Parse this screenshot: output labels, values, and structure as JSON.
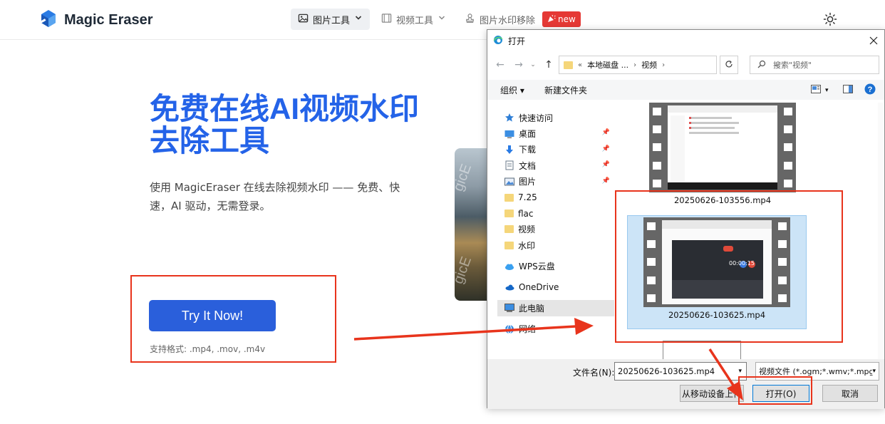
{
  "header": {
    "logo_text": "Magic Eraser",
    "nav": [
      {
        "label": "图片工具",
        "active": true
      },
      {
        "label": "视频工具",
        "active": false
      },
      {
        "label": "图片水印移除",
        "active": false
      }
    ],
    "badge_new": "new"
  },
  "hero": {
    "title": "免费在线AI视频水印去除工具",
    "description": "使用 MagicEraser 在线去除视频水印 —— 免费、快速，AI 驱动，无需登录。",
    "cta_label": "Try It Now!",
    "formats": "支持格式: .mp4, .mov, .m4v",
    "image_watermark_1": "gicE",
    "image_watermark_2": "gicE"
  },
  "dialog": {
    "title": "打开",
    "address": {
      "prefix": "«",
      "part1": "本地磁盘 ...",
      "part2": "视频"
    },
    "search_placeholder": "搜索\"视频\"",
    "toolbar": {
      "organize": "组织",
      "new_folder": "新建文件夹"
    },
    "sidebar": [
      {
        "label": "快速访问",
        "icon": "star-icon"
      },
      {
        "label": "桌面",
        "icon": "desktop-icon",
        "pinned": true
      },
      {
        "label": "下载",
        "icon": "download-icon",
        "pinned": true
      },
      {
        "label": "文档",
        "icon": "document-icon",
        "pinned": true
      },
      {
        "label": "图片",
        "icon": "picture-icon",
        "pinned": true
      },
      {
        "label": "7.25",
        "icon": "folder-icon"
      },
      {
        "label": "flac",
        "icon": "folder-icon"
      },
      {
        "label": "视频",
        "icon": "folder-icon"
      },
      {
        "label": "水印",
        "icon": "folder-icon"
      },
      {
        "label": "WPS云盘",
        "icon": "cloud-icon"
      },
      {
        "label": "OneDrive",
        "icon": "onedrive-icon"
      },
      {
        "label": "此电脑",
        "icon": "computer-icon",
        "selected": true
      },
      {
        "label": "网络",
        "icon": "network-icon"
      }
    ],
    "files": [
      {
        "name": "20250626-103556.mp4",
        "selected": false
      },
      {
        "name": "20250626-103625.mp4",
        "selected": true
      }
    ],
    "thumb2_text": "00:00:15",
    "filename_label": "文件名(N):",
    "filename_value": "20250626-103625.mp4",
    "filetype": "视频文件 (*.ogm;*.wmv;*.mpg",
    "btn_mobile": "从移动设备上传",
    "btn_open": "打开(O)",
    "btn_cancel": "取消"
  },
  "colors": {
    "brand_blue": "#2463e8",
    "cta_blue": "#2a5fdb",
    "annotation_red": "#e8341c",
    "badge_red": "#e53935"
  }
}
